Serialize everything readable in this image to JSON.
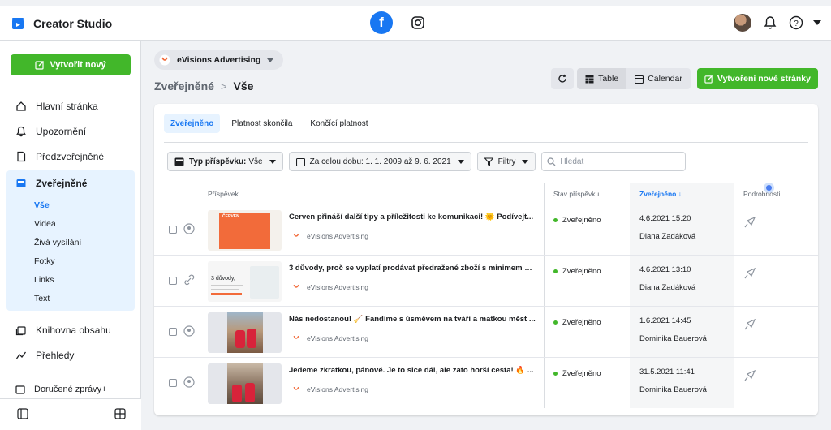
{
  "app": {
    "title": "Creator Studio"
  },
  "topbar": {
    "platforms": [
      "facebook-icon",
      "instagram-icon"
    ],
    "right_icons": [
      "avatar",
      "bell-icon",
      "help-icon",
      "caret-down-icon"
    ]
  },
  "sidebar": {
    "create_label": "Vytvořit nový",
    "items": [
      {
        "label": "Hlavní stránka",
        "icon": "home-icon"
      },
      {
        "label": "Upozornění",
        "icon": "bell-icon"
      },
      {
        "label": "Předzveřejněné",
        "icon": "document-icon"
      }
    ],
    "group": {
      "label": "Zveřejněné",
      "icon": "posts-icon",
      "subitems": [
        "Vše",
        "Videa",
        "Živá vysílání",
        "Fotky",
        "Links",
        "Text"
      ]
    },
    "items2": [
      {
        "label": "Knihovna obsahu",
        "icon": "library-icon"
      },
      {
        "label": "Přehledy",
        "icon": "insights-icon"
      }
    ],
    "partial_item": "Doručené zprávy+"
  },
  "page_selector": "eVisions Advertising",
  "breadcrumb": {
    "parent": "Zveřejněné",
    "separator": ">",
    "current": "Vše"
  },
  "toolbar": {
    "table_label": "Table",
    "calendar_label": "Calendar",
    "create_page_label": "Vytvoření nové stránky"
  },
  "tabs": [
    "Zveřejněno",
    "Platnost skončila",
    "Končící platnost"
  ],
  "filters": {
    "type_label": "Typ příspěvku:",
    "type_value": "Vše",
    "date_label": "Za celou dobu: 1. 1. 2009 až 9. 6. 2021",
    "filter_label": "Filtry",
    "search_placeholder": "Hledat"
  },
  "table": {
    "columns": [
      "Příspěvek",
      "Stav příspěvku",
      "Zveřejněno ↓",
      "Podrobnosti"
    ],
    "rows": [
      {
        "title": "Červen přináší další tipy a příležitosti ke komunikaci! 🌞 Podívejt...",
        "page": "eVisions Advertising",
        "status": "Zveřejněno",
        "date": "4.6.2021 15:20",
        "author": "Diana Zadáková",
        "type": "photo",
        "thumb_text": "ČERVEN"
      },
      {
        "title": "3 důvody, proč se vyplatí prodávat předražené zboží s minimem vý...",
        "page": "eVisions Advertising",
        "status": "Zveřejněno",
        "date": "4.6.2021 13:10",
        "author": "Diana Zadáková",
        "type": "link",
        "thumb_text": "3 důvody,"
      },
      {
        "title": "Nás nedostanou! 🧹 Fandíme s úsměvem na tváři a matkou měst ...",
        "page": "eVisions Advertising",
        "status": "Zveřejněno",
        "date": "1.6.2021 14:45",
        "author": "Dominika Bauerová",
        "type": "photo",
        "thumb_text": ""
      },
      {
        "title": "Jedeme zkratkou, pánové. Je to sice dál, ale zato horší cesta! 🔥 ...",
        "page": "eVisions Advertising",
        "status": "Zveřejněno",
        "date": "31.5.2021 11:41",
        "author": "Dominika Bauerová",
        "type": "photo",
        "thumb_text": ""
      }
    ]
  },
  "colors": {
    "accent": "#1877f2",
    "green": "#42b72a",
    "background": "#f0f2f5",
    "orange": "#f26b3a"
  }
}
